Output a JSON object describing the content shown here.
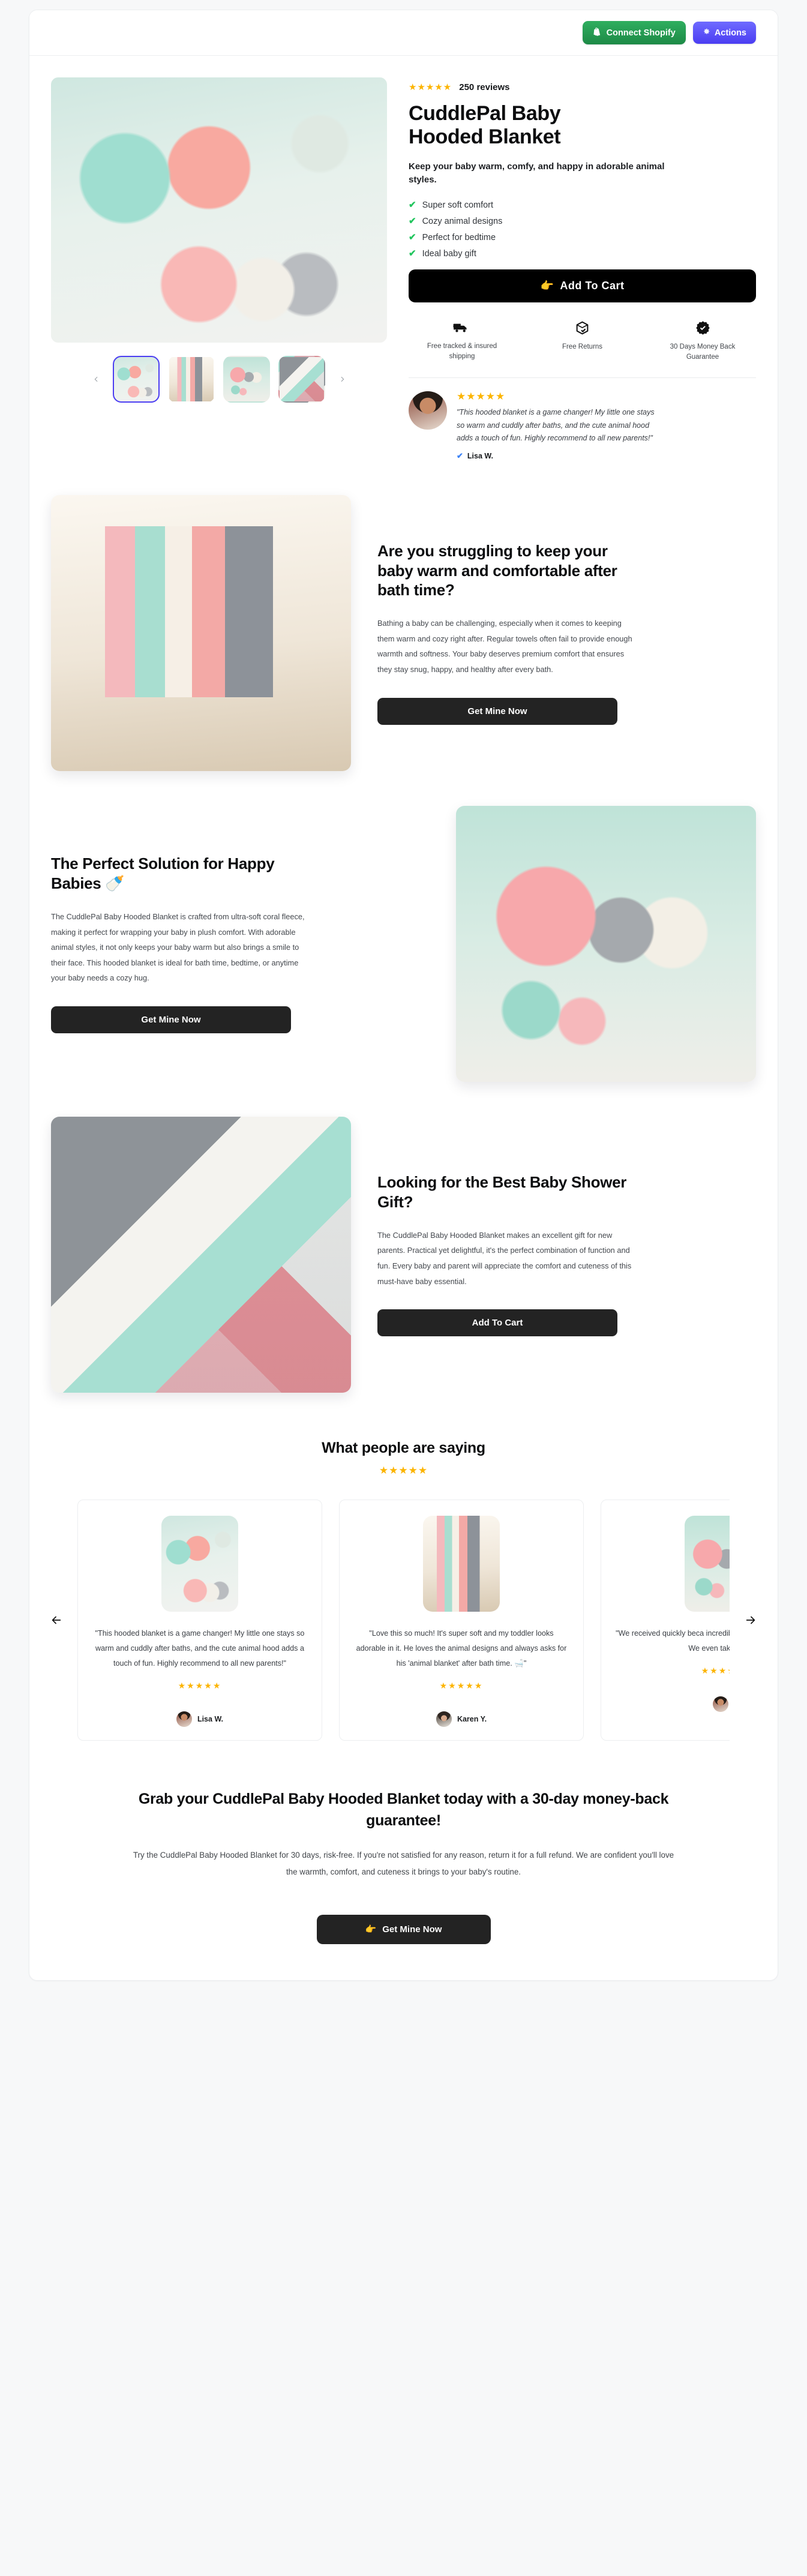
{
  "topbar": {
    "connect_shopify": "Connect Shopify",
    "actions": "Actions"
  },
  "hero": {
    "reviews_count": "250 reviews",
    "stars": "★★★★★",
    "title": "CuddlePal Baby Hooded Blanket",
    "subtitle": "Keep your baby warm, comfy, and happy in adorable animal styles.",
    "benefits": [
      "Super soft comfort",
      "Cozy animal designs",
      "Perfect for bedtime",
      "Ideal baby gift"
    ],
    "cta": "Add To Cart",
    "cta_icon": "👉",
    "trust": [
      {
        "icon": "truck-icon",
        "label": "Free tracked & insured shipping"
      },
      {
        "icon": "box-check-icon",
        "label": "Free Returns"
      },
      {
        "icon": "badge-check-icon",
        "label": "30 Days Money Back Guarantee"
      }
    ],
    "testimonial": {
      "stars": "★★★★★",
      "quote": "\"This hooded blanket is a game changer! My little one stays so warm and cuddly after baths, and the cute animal hood adds a touch of fun. Highly recommend to all new parents!\"",
      "name": "Lisa W.",
      "verified_icon": "verified-badge-icon"
    }
  },
  "features": [
    {
      "heading": "Are you struggling to keep your baby warm and comfortable after bath time?",
      "body": "Bathing a baby can be challenging, especially when it comes to keeping them warm and cozy right after. Regular towels often fail to provide enough warmth and softness. Your baby deserves premium comfort that ensures they stay snug, happy, and healthy after every bath.",
      "button": "Get Mine Now"
    },
    {
      "heading": "The Perfect Solution for Happy Babies 🍼",
      "body": "The CuddlePal Baby Hooded Blanket is crafted from ultra-soft coral fleece, making it perfect for wrapping your baby in plush comfort. With adorable animal styles, it not only keeps your baby warm but also brings a smile to their face. This hooded blanket is ideal for bath time, bedtime, or anytime your baby needs a cozy hug.",
      "button": "Get Mine Now"
    },
    {
      "heading": "Looking for the Best Baby Shower Gift?",
      "body": "The CuddlePal Baby Hooded Blanket makes an excellent gift for new parents. Practical yet delightful, it's the perfect combination of function and fun. Every baby and parent will appreciate the comfort and cuteness of this must-have baby essential.",
      "button": "Add To Cart"
    }
  ],
  "reviews_section": {
    "heading": "What people are saying",
    "stars": "★★★★★",
    "prev_icon": "arrow-left-icon",
    "next_icon": "arrow-right-icon",
    "cards": [
      {
        "quote": "\"This hooded blanket is a game changer! My little one stays so warm and cuddly after baths, and the cute animal hood adds a touch of fun. Highly recommend to all new parents!\"",
        "stars": "★★★★★",
        "name": "Lisa W."
      },
      {
        "quote": "\"Love this so much! It's super soft and my toddler looks adorable in it. He loves the animal designs and always asks for his 'animal blanket' after bath time. 🛁\"",
        "stars": "★★★★★",
        "name": "Karen Y."
      },
      {
        "quote": "\"We received quickly beca incredibly so baby warm Perfect for b We even take the ba",
        "stars": "★★★★★",
        "name": ""
      }
    ]
  },
  "final_cta": {
    "heading": "Grab your CuddlePal Baby Hooded Blanket today with a 30-day money-back guarantee!",
    "body": "Try the CuddlePal Baby Hooded Blanket for 30 days, risk-free. If you're not satisfied for any reason, return it for a full refund. We are confident you'll love the warmth, comfort, and cuteness it brings to your baby's routine.",
    "button": "Get Mine Now",
    "button_icon": "👉"
  },
  "colors": {
    "shopify_green": "#1d8a46",
    "actions_purple": "#4b3df2",
    "star_gold": "#fcb400",
    "check_green": "#22c55e",
    "cta_black": "#000000",
    "cta_dark": "#232323",
    "verified_blue": "#3b82f6"
  }
}
